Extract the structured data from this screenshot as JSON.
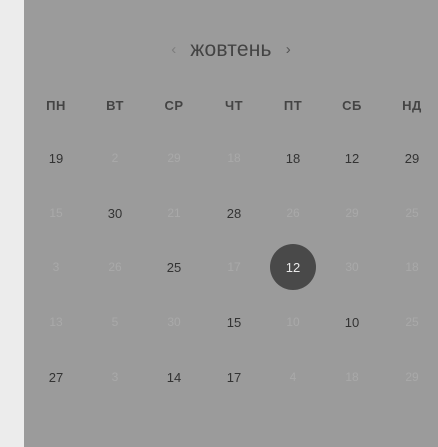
{
  "calendar": {
    "month": "жовтень",
    "prev_arrow": "‹",
    "next_arrow": "›",
    "weekdays": [
      "ПН",
      "ВТ",
      "СР",
      "ЧТ",
      "ПТ",
      "СБ",
      "НД"
    ],
    "rows": [
      [
        {
          "d": "19",
          "m": false
        },
        {
          "d": "2",
          "m": true
        },
        {
          "d": "29",
          "m": true
        },
        {
          "d": "18",
          "m": true
        },
        {
          "d": "18",
          "m": false
        },
        {
          "d": "12",
          "m": false
        },
        {
          "d": "29",
          "m": false
        }
      ],
      [
        {
          "d": "15",
          "m": true
        },
        {
          "d": "30",
          "m": false
        },
        {
          "d": "21",
          "m": true
        },
        {
          "d": "28",
          "m": false
        },
        {
          "d": "26",
          "m": true
        },
        {
          "d": "29",
          "m": true
        },
        {
          "d": "25",
          "m": true
        }
      ],
      [
        {
          "d": "3",
          "m": true
        },
        {
          "d": "26",
          "m": true
        },
        {
          "d": "25",
          "m": false
        },
        {
          "d": "17",
          "m": true
        },
        {
          "d": "12",
          "m": false,
          "selected": true
        },
        {
          "d": "30",
          "m": true
        },
        {
          "d": "18",
          "m": true
        }
      ],
      [
        {
          "d": "13",
          "m": true
        },
        {
          "d": "5",
          "m": true
        },
        {
          "d": "30",
          "m": true
        },
        {
          "d": "15",
          "m": false
        },
        {
          "d": "10",
          "m": true
        },
        {
          "d": "10",
          "m": false
        },
        {
          "d": "25",
          "m": true
        }
      ],
      [
        {
          "d": "27",
          "m": false
        },
        {
          "d": "3",
          "m": true
        },
        {
          "d": "14",
          "m": false
        },
        {
          "d": "17",
          "m": false
        },
        {
          "d": "4",
          "m": true
        },
        {
          "d": "18",
          "m": true
        },
        {
          "d": "29",
          "m": true
        }
      ]
    ]
  },
  "colors": {
    "panel_bg": "#9b9b9b",
    "selected_bg": "#494949",
    "muted_text": "#a9a9a9"
  }
}
